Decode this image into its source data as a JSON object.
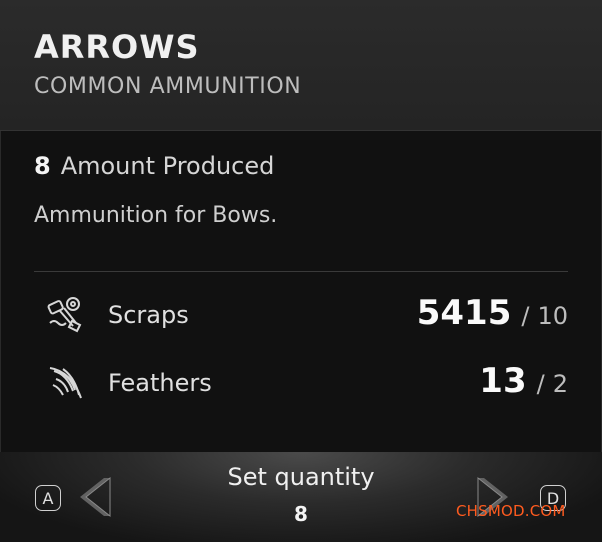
{
  "header": {
    "title": "ARROWS",
    "subtitle": "COMMON AMMUNITION"
  },
  "details": {
    "amount_produced_value": "8",
    "amount_produced_label": "Amount Produced",
    "description": "Ammunition for Bows."
  },
  "resources": [
    {
      "name": "Scraps",
      "have": "5415",
      "separator": "/",
      "required": "10",
      "icon": "scrap-icon"
    },
    {
      "name": "Feathers",
      "have": "13",
      "separator": "/",
      "required": "2",
      "icon": "feather-icon"
    }
  ],
  "footer": {
    "left_key": "A",
    "right_key": "D",
    "set_quantity_label": "Set quantity",
    "quantity": "8"
  },
  "watermark": "CHSMOD.COM"
}
